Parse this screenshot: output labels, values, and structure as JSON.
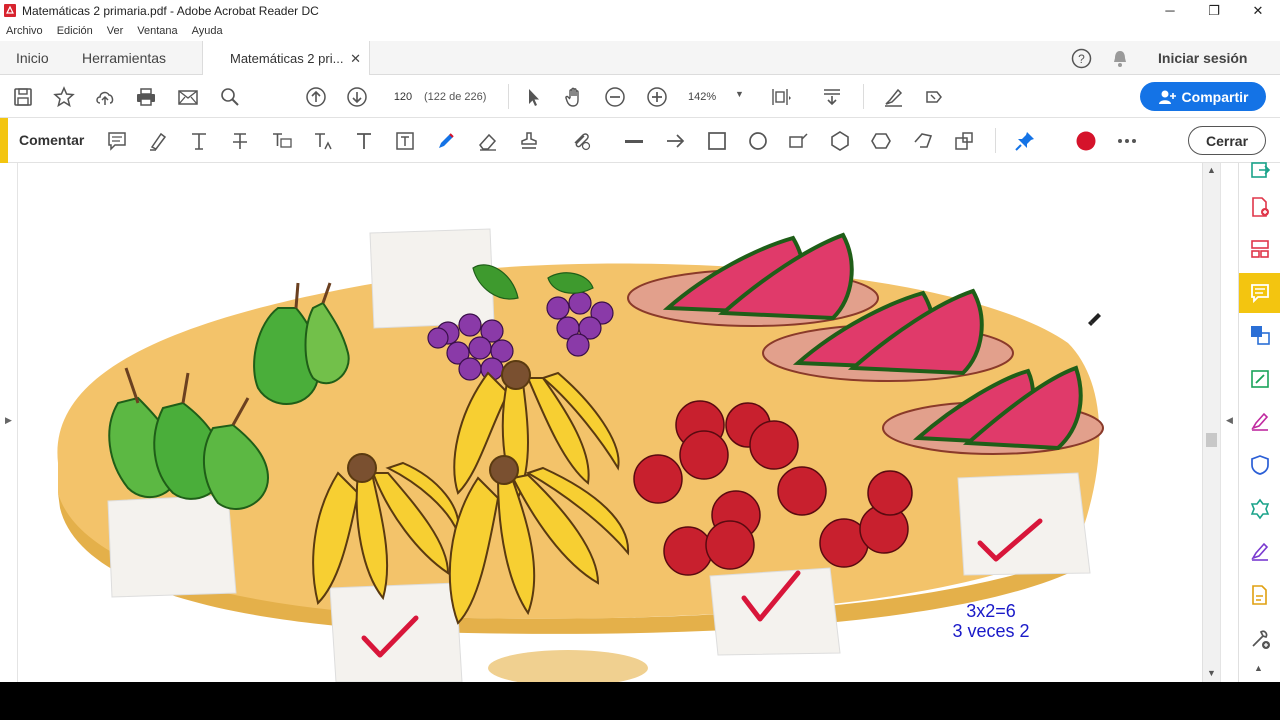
{
  "window": {
    "title": "Matemáticas 2 primaria.pdf - Adobe Acrobat Reader DC",
    "minimize": "─",
    "restore": "❐",
    "close": "✕"
  },
  "menu": {
    "items": [
      "Archivo",
      "Edición",
      "Ver",
      "Ventana",
      "Ayuda"
    ]
  },
  "tabs": {
    "home": "Inicio",
    "tools": "Herramientas",
    "document": "Matemáticas 2 pri...",
    "document_close": "✕",
    "sign_in": "Iniciar sesión"
  },
  "toolbar": {
    "page_number": "120",
    "page_info": "(122 de 226)",
    "zoom": "142%",
    "share_label": "Compartir"
  },
  "comment_bar": {
    "label": "Comentar",
    "close_label": "Cerrar",
    "color_active": "#d5132b"
  },
  "annotations": {
    "line1": "3x2=6",
    "line2": "3 veces 2"
  },
  "colors": {
    "accent_yellow": "#f3c510",
    "share_blue": "#1473e6",
    "check_red": "#d8163a",
    "annotation_blue": "#1a1ac8"
  }
}
